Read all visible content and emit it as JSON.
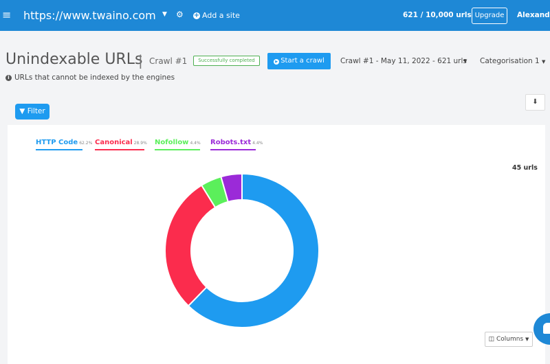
{
  "topbar": {
    "site_url": "https://www.twaino.com",
    "add_site_label": "Add a site",
    "quota": "621 / 10,000 urls",
    "upgrade_label": "Upgrade",
    "user_name": "Alexandre"
  },
  "header": {
    "title": "Unindexable URLs",
    "separator": "|",
    "crawl_label": "Crawl #1",
    "status_badge": "Successfully completed",
    "start_crawl_label": "Start a crawl",
    "crawl_select": "Crawl #1 - May 11, 2022 - 621 urls",
    "categorisation_select": "Categorisation 1",
    "subtitle": "URLs that cannot be indexed by the engines"
  },
  "toolbar": {
    "filter_label": "Filter",
    "columns_label": "Columns"
  },
  "chart_data": {
    "type": "pie",
    "donut": true,
    "total_label": "45 urls",
    "series": [
      {
        "name": "HTTP Code",
        "value": 62.2,
        "label": "62.2%",
        "color": "#1e9bf0"
      },
      {
        "name": "Canonical",
        "value": 28.9,
        "label": "28.9%",
        "color": "#fb2c4d"
      },
      {
        "name": "Nofollow",
        "value": 4.4,
        "label": "4.4%",
        "color": "#5bef5b"
      },
      {
        "name": "Robots.txt",
        "value": 4.4,
        "label": "4.4%",
        "color": "#9b2ad8"
      }
    ],
    "legend_placement": "top-left"
  },
  "icons": {
    "menu": "hamburger-icon",
    "site_caret": "caret-down-icon",
    "settings": "gear-icon",
    "add": "plus-circle-icon",
    "play": "play-circle-icon",
    "info": "info-circle-icon",
    "filter": "funnel-icon",
    "download": "download-icon",
    "columns": "columns-icon",
    "chat": "chat-icon"
  }
}
